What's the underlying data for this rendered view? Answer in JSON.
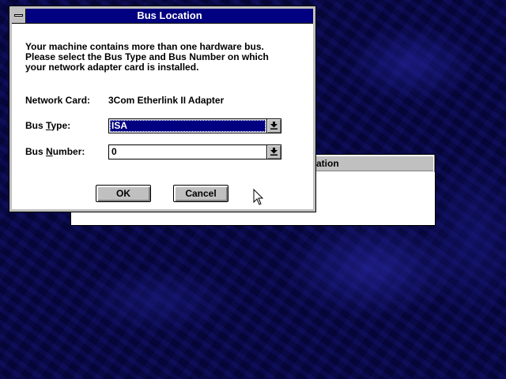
{
  "background_window": {
    "title_fragment": "ation"
  },
  "dialog": {
    "title": "Bus Location",
    "message_lines": [
      "Your machine contains more than one hardware bus.",
      "Please select the Bus Type and Bus Number on which",
      "your network adapter card is installed."
    ],
    "network_card": {
      "label": "Network Card:",
      "value": "3Com Etherlink II Adapter"
    },
    "bus_type": {
      "label_pre": "Bus ",
      "label_key": "T",
      "label_post": "ype:",
      "value": "ISA"
    },
    "bus_number": {
      "label_pre": "Bus ",
      "label_key": "N",
      "label_post": "umber:",
      "value": "0"
    },
    "ok_label": "OK",
    "cancel_label": "Cancel"
  },
  "colors": {
    "titlebar_active": "#000080",
    "face": "#c0c0c0",
    "selection": "#000080",
    "desktop": "#06063f"
  },
  "icons": [
    "system-menu-icon",
    "dropdown-arrow-icon",
    "mouse-pointer-icon"
  ]
}
